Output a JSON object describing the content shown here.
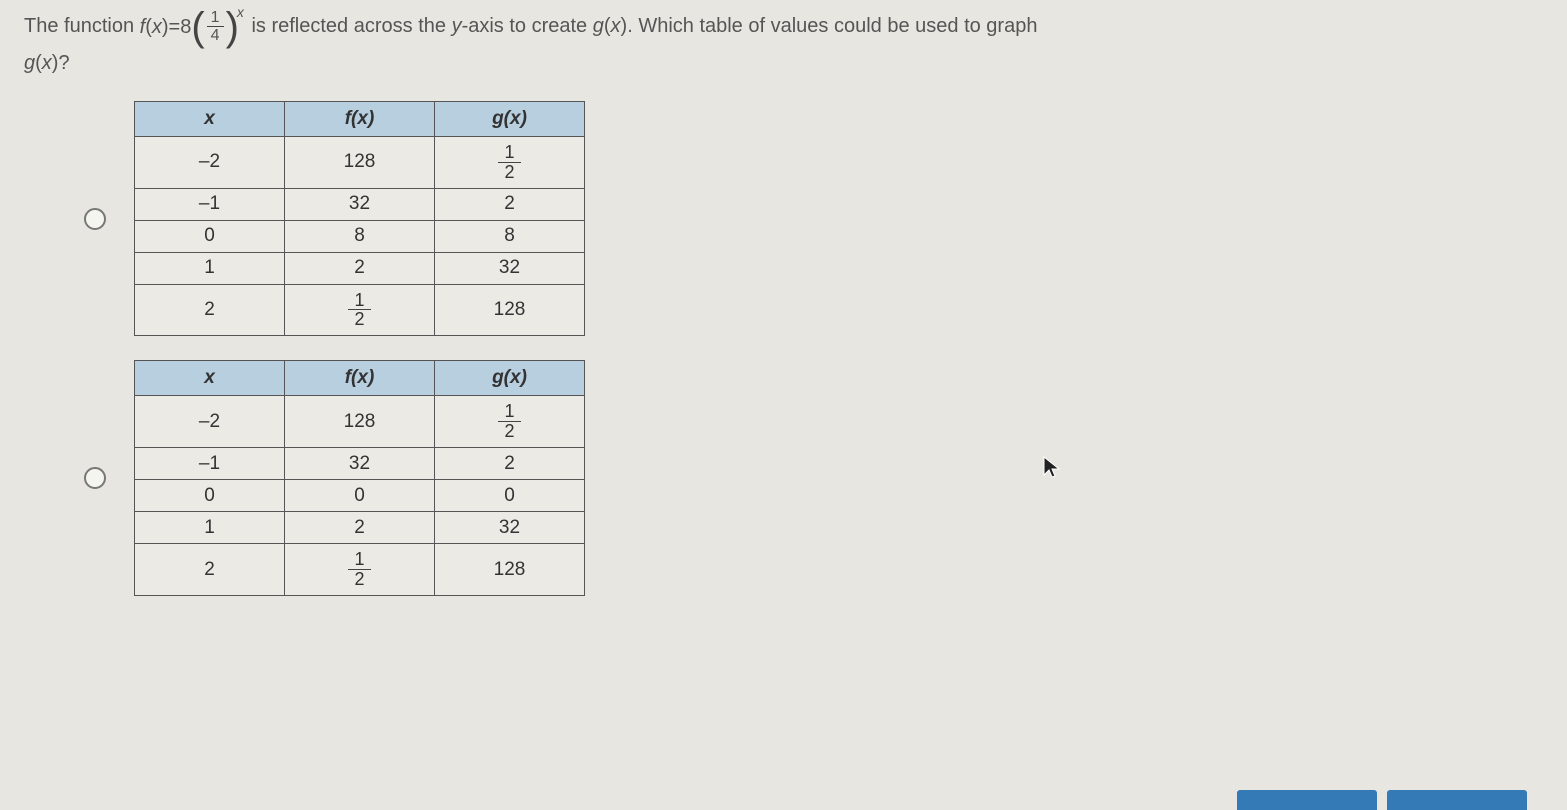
{
  "question": {
    "prefix": "The function ",
    "lhs_func": "f",
    "lhs_arg": "x",
    "equals": " = ",
    "coeff": "8",
    "frac_num": "1",
    "frac_den": "4",
    "exp": "x",
    "mid": " is reflected across the ",
    "axis_var": "y",
    "axis_suffix": "-axis to create ",
    "rhs_func": "g",
    "rhs_arg": "x",
    "suffix": ". Which table of values could be used to graph",
    "line2_func": "g",
    "line2_arg": "x",
    "line2_suffix": "?"
  },
  "headers": {
    "x": "x",
    "fx": "f(x)",
    "gx": "g(x)"
  },
  "options": [
    {
      "rows": [
        {
          "x": "–2",
          "fx": {
            "type": "plain",
            "val": "128"
          },
          "gx": {
            "type": "frac",
            "num": "1",
            "den": "2"
          }
        },
        {
          "x": "–1",
          "fx": {
            "type": "plain",
            "val": "32"
          },
          "gx": {
            "type": "plain",
            "val": "2"
          }
        },
        {
          "x": "0",
          "fx": {
            "type": "plain",
            "val": "8"
          },
          "gx": {
            "type": "plain",
            "val": "8"
          }
        },
        {
          "x": "1",
          "fx": {
            "type": "plain",
            "val": "2"
          },
          "gx": {
            "type": "plain",
            "val": "32"
          }
        },
        {
          "x": "2",
          "fx": {
            "type": "frac",
            "num": "1",
            "den": "2"
          },
          "gx": {
            "type": "plain",
            "val": "128"
          }
        }
      ]
    },
    {
      "rows": [
        {
          "x": "–2",
          "fx": {
            "type": "plain",
            "val": "128"
          },
          "gx": {
            "type": "frac",
            "num": "1",
            "den": "2"
          }
        },
        {
          "x": "–1",
          "fx": {
            "type": "plain",
            "val": "32"
          },
          "gx": {
            "type": "plain",
            "val": "2"
          }
        },
        {
          "x": "0",
          "fx": {
            "type": "plain",
            "val": "0"
          },
          "gx": {
            "type": "plain",
            "val": "0"
          }
        },
        {
          "x": "1",
          "fx": {
            "type": "plain",
            "val": "2"
          },
          "gx": {
            "type": "plain",
            "val": "32"
          }
        },
        {
          "x": "2",
          "fx": {
            "type": "frac",
            "num": "1",
            "den": "2"
          },
          "gx": {
            "type": "plain",
            "val": "128"
          }
        }
      ]
    }
  ]
}
